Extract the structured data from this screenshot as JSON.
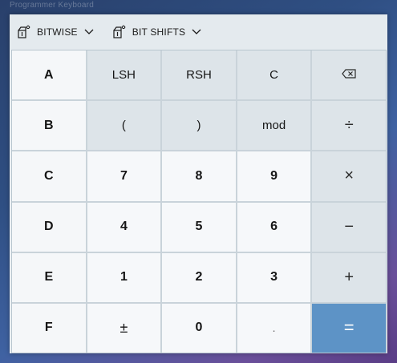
{
  "window": {
    "caption": "Programmer Keyboard"
  },
  "toolbar": {
    "bitwise_label": "BITWISE",
    "bitshifts_label": "BIT SHIFTS"
  },
  "keys": {
    "a": "A",
    "b": "B",
    "c": "C",
    "d": "D",
    "e": "E",
    "f": "F",
    "lsh": "LSH",
    "rsh": "RSH",
    "clear": "C",
    "open_paren": "(",
    "close_paren": ")",
    "mod": "mod",
    "n7": "7",
    "n8": "8",
    "n9": "9",
    "n4": "4",
    "n5": "5",
    "n6": "6",
    "n1": "1",
    "n2": "2",
    "n3": "3",
    "negate": "±",
    "n0": "0",
    "decimal": ".",
    "divide": "÷",
    "multiply": "×",
    "minus": "−",
    "plus": "+",
    "equals": "="
  },
  "icons": {
    "toolbar": "bitwise-icon",
    "backspace": "backspace-icon",
    "dropdown": "chevron-down-icon"
  },
  "colors": {
    "equals_key": "#5d93c6",
    "operator_key": "#dde4e9",
    "number_key": "#f6f8fa"
  }
}
